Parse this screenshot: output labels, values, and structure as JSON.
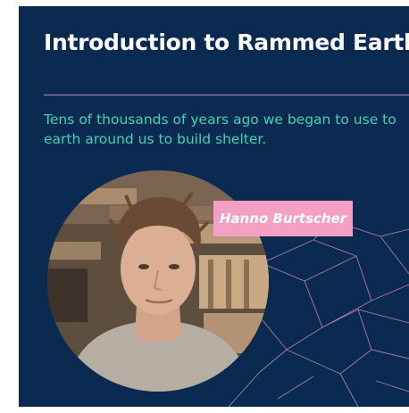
{
  "header": {
    "title": "Introduction to Rammed Earth"
  },
  "intro": {
    "text": "Tens of thousands of years ago we began to use to earth around us to build shelter."
  },
  "speaker": {
    "name": "Hanno Burtscher"
  },
  "colors": {
    "background": "#0a2a52",
    "divider": "#c48ab6",
    "intro_text": "#3fd1b3",
    "name_tag": "#f4a0c4",
    "pattern_lines": "#c48ab6"
  }
}
